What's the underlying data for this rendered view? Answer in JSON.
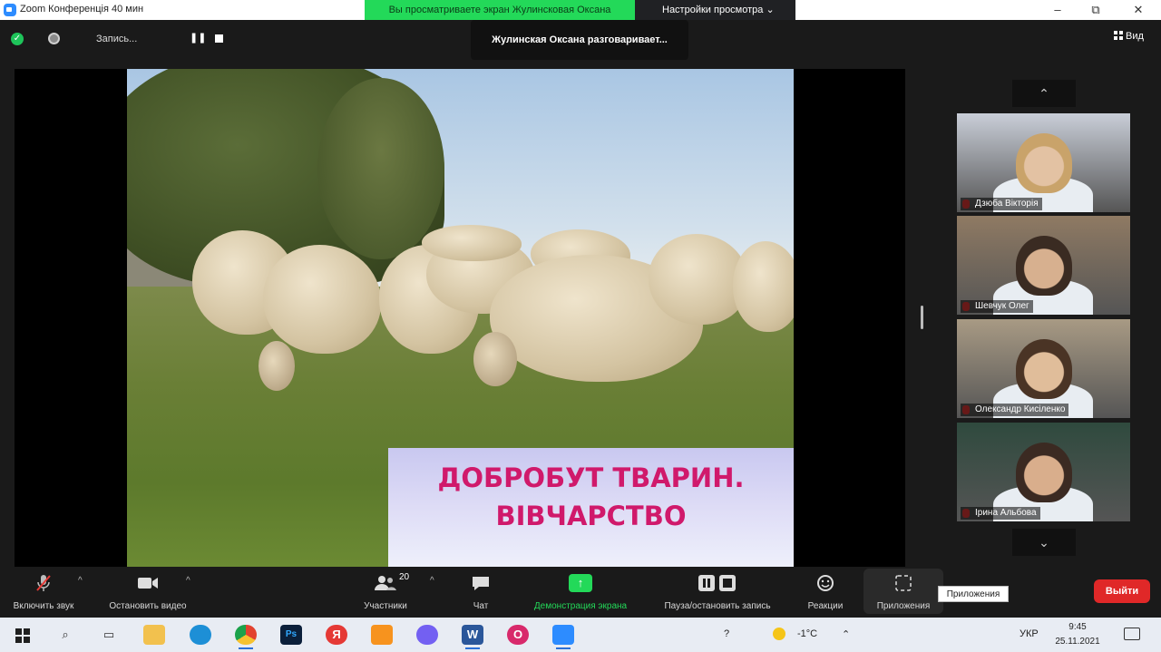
{
  "window": {
    "title": "Zoom Конференція 40 мин",
    "share_banner": "Вы просматриваете экран Жулинсковая Оксана",
    "view_options": "Настройки просмотра ⌄",
    "minimize": "–",
    "restore": "⧉",
    "close": "✕"
  },
  "meeting": {
    "recording_label": "Запись...",
    "pause_label": "❚❚",
    "speaking_banner": "Жулинская Оксана разговаривает...",
    "view_label": "Вид"
  },
  "slide": {
    "title_line1": "ДОБРОБУТ ТВАРИН.",
    "title_line2": "ВІВЧАРСТВО",
    "title_color": "#d0196b"
  },
  "gallery": {
    "up_label": "⌃",
    "down_label": "⌄",
    "participants": [
      {
        "name": "Дзюба Вікторія",
        "bg": "#c9ced8",
        "skin": "#e3c2a3",
        "hair": "#c9a36a"
      },
      {
        "name": "Шевчук Олег",
        "bg": "#8f7a63",
        "skin": "#d7b08f",
        "hair": "#3a2b22"
      },
      {
        "name": "Олександр Кисіленко",
        "bg": "#a89a84",
        "skin": "#e0bd9a",
        "hair": "#4a3425"
      },
      {
        "name": "Ірина Альбова",
        "bg": "#2f4a3e",
        "skin": "#d9ae8c",
        "hair": "#3b2a22"
      }
    ]
  },
  "toolbar": {
    "mute_label": "Включить звук",
    "video_label": "Остановить видео",
    "participants_label": "Участники",
    "participants_count": "20",
    "chat_label": "Чат",
    "share_label": "Демонстрация экрана",
    "record_label": "Пауза/остановить запись",
    "reactions_label": "Реакции",
    "apps_label": "Приложения",
    "apps_tooltip": "Приложения",
    "leave_label": "Выйти",
    "caret": "^"
  },
  "taskbar": {
    "temperature": "-1°C",
    "language": "УКР",
    "time": "9:45",
    "date": "25.11.2021"
  },
  "colors": {
    "share_green": "#23d959",
    "leave_red": "#e02828",
    "zoom_blue": "#2d8cff"
  },
  "icons": [
    "zoom-app-icon",
    "shield-icon",
    "record-icon",
    "pause-icon",
    "stop-icon",
    "grid-view-icon",
    "chevron-up-icon",
    "chevron-down-icon",
    "muted-mic-icon",
    "video-camera-icon",
    "participants-icon",
    "chat-icon",
    "share-screen-icon",
    "record-pause-stop-icon",
    "reactions-icon",
    "apps-icon",
    "windows-start-icon",
    "search-icon",
    "task-view-icon",
    "file-explorer-icon",
    "edge-icon",
    "chrome-icon",
    "photoshop-icon",
    "yandex-icon",
    "ok-icon",
    "viber-icon",
    "word-icon",
    "opera-icon",
    "zoom-taskbar-icon",
    "weather-icon",
    "notification-icon"
  ]
}
